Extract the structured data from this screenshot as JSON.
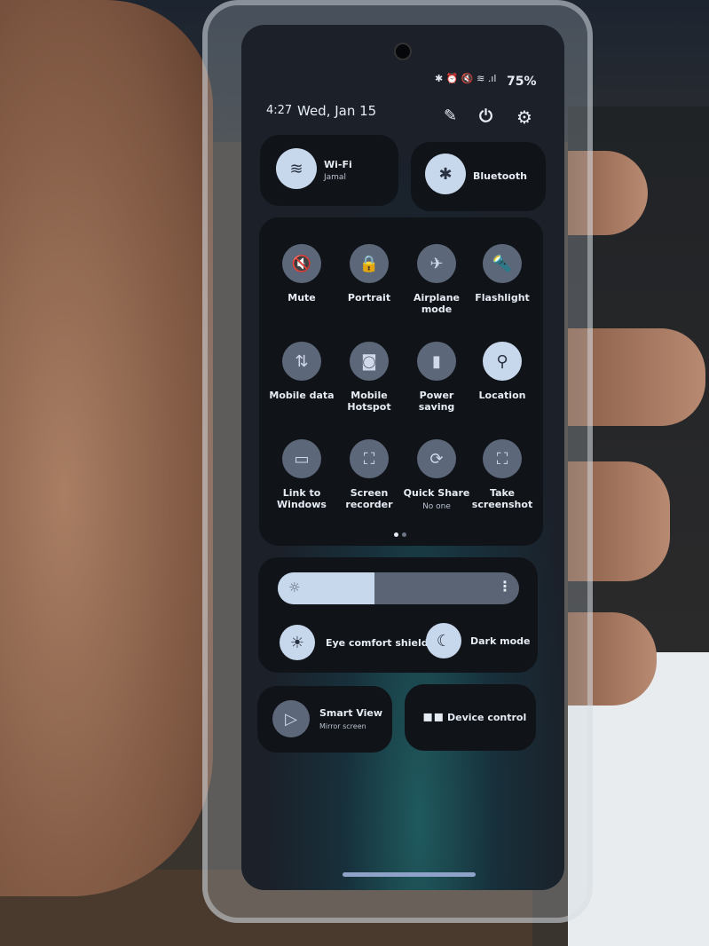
{
  "status_bar": {
    "icons": [
      "bluetooth-icon",
      "alarm-icon",
      "mute-icon",
      "wifi-icon",
      "signal-icon"
    ],
    "battery": "75%"
  },
  "header": {
    "time": "4:27",
    "date": "Wed, Jan 15",
    "icons": [
      "edit-icon",
      "power-icon",
      "settings-icon"
    ]
  },
  "wifi": {
    "label": "Wi-Fi",
    "network": "Jamal",
    "on": true
  },
  "bluetooth": {
    "label": "Bluetooth",
    "on": true
  },
  "tiles": [
    {
      "label": "Mute",
      "icon": "mute-icon",
      "glyph": "🔇",
      "on": false
    },
    {
      "label": "Portrait",
      "icon": "portrait-lock-icon",
      "glyph": "🔒",
      "on": false
    },
    {
      "label": "Airplane mode",
      "icon": "airplane-icon",
      "glyph": "✈",
      "on": false
    },
    {
      "label": "Flashlight",
      "icon": "flashlight-icon",
      "glyph": "🔦",
      "on": false
    },
    {
      "label": "Mobile data",
      "icon": "mobile-data-icon",
      "glyph": "⇅",
      "on": false
    },
    {
      "label": "Mobile Hotspot",
      "icon": "hotspot-icon",
      "glyph": "◙",
      "on": false
    },
    {
      "label": "Power saving",
      "icon": "power-saving-icon",
      "glyph": "▮",
      "on": false
    },
    {
      "label": "Location",
      "icon": "location-icon",
      "glyph": "⚲",
      "on": true
    },
    {
      "label": "Link to Windows",
      "icon": "link-to-windows-icon",
      "glyph": "▭",
      "on": false
    },
    {
      "label": "Screen recorder",
      "icon": "screen-recorder-icon",
      "glyph": "⛶",
      "on": false
    },
    {
      "label": "Quick Share",
      "sub": "No one",
      "icon": "quick-share-icon",
      "glyph": "⟳",
      "on": false
    },
    {
      "label": "Take screenshot",
      "icon": "screenshot-icon",
      "glyph": "⛶",
      "on": false
    }
  ],
  "pager": {
    "pages": 2,
    "current": 1
  },
  "brightness": {
    "level_percent": 40,
    "icon": "sun-icon"
  },
  "eye_comfort": {
    "label": "Eye comfort shield",
    "on": true
  },
  "dark_mode": {
    "label": "Dark mode",
    "on": true
  },
  "smart_view": {
    "label": "Smart View",
    "sub": "Mirror screen"
  },
  "device_control": {
    "label": "Device control"
  }
}
